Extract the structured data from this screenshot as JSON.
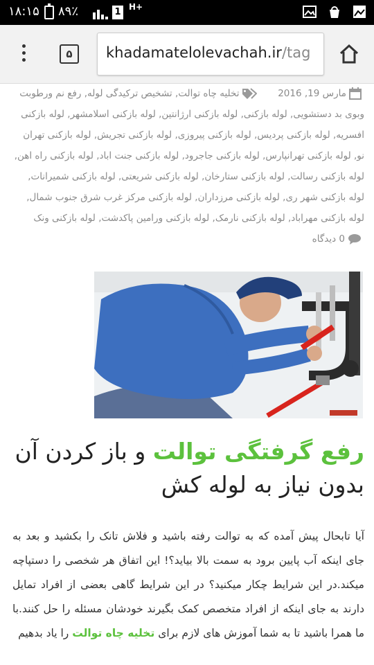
{
  "status_bar": {
    "time": "۱۸:۱۵",
    "battery": "۸۹٪",
    "sim": "1",
    "network": "H+"
  },
  "toolbar": {
    "tab_count": "۵",
    "url_host": "khadamatelolevachah.ir",
    "url_path": "/tag"
  },
  "post_meta": {
    "date": "مارس 19, 2016",
    "tags": "تخلیه چاه توالت, تشخیص ترکیدگی لوله, رفع نم ورطوبت وبوی بد دستشویی, لوله بازکنی, لوله بازکنی ارژانتین, لوله بازکنی اسلامشهر, لوله بازکنی افسریه, لوله بازکنی پردیس, لوله بازکنی پیروزی, لوله بازکنی تجریش, لوله بازکنی تهران نو, لوله بازکنی تهرانپارس, لوله بازکنی جاجرود, لوله بازکنی جنت اباد, لوله بازکنی راه اهن, لوله بازکنی رسالت, لوله بازکنی ستارخان, لوله بازکنی شریعتی, لوله بازکنی شمیرانات, لوله بازکنی شهر ری, لوله بازکنی مرزداران, لوله بازکنی مرکز غرب شرق جنوب شمال, لوله بازکنی مهراباد, لوله بازکنی نارمک, لوله بازکنی ورامین پاکدشت, لوله بازکنی ونک",
    "comments": "0 دیدگاه"
  },
  "article": {
    "title_green": "رفع گرفتگی توالت",
    "title_rest": " و باز کردن آن بدون نیاز به لوله کش",
    "body_text": "آیا تابحال پیش آمده که به توالت رفته باشید و فلاش تانک را بکشید و بعد به جای اینکه آب پایین برود به سمت بالا بیاید؟! این اتفاق هر شخصی را دستپاچه میکند.در این شرایط چکار میکنید؟ در این شرایط گاهی بعضی از افراد تمایل دارند به جای اینکه از افراد متخصص کمک بگیرند خودشان مسئله را حل کنند.با ما همرا باشید تا به شما آموزش های لازم برای ",
    "body_link": "تخلیه چاه توالت",
    "body_end": " را یاد بدهیم"
  },
  "colors": {
    "accent_green": "#5cc13d",
    "status_bar": "#000000",
    "toolbar": "#f2f2f2",
    "meta_gray": "#8a8a8a"
  }
}
